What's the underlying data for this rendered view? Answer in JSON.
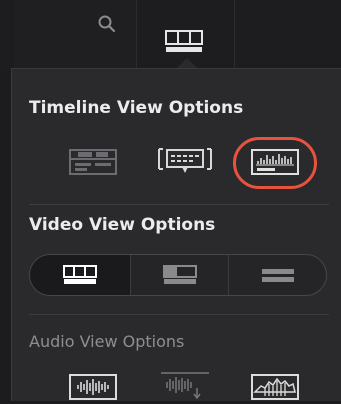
{
  "colors": {
    "background": "#1c1c1f",
    "popover": "#2a2a2d",
    "highlight": "#e8533f",
    "text": "#ececec",
    "text_dim": "#8e8e92"
  },
  "toolbar": {
    "icons": [
      "search-icon",
      "timeline-view-options-icon"
    ]
  },
  "popover": {
    "timeline_view": {
      "title": "Timeline View Options",
      "buttons": [
        "stacked-timelines-icon",
        "subtitle-track-icon",
        "audio-waveform-icon"
      ],
      "highlighted": "audio-waveform-icon"
    },
    "video_view": {
      "title": "Video View Options",
      "segments": [
        "filmstrip-view-icon",
        "thumbnail-view-icon",
        "continuous-view-icon"
      ],
      "selected": "filmstrip-view-icon"
    },
    "audio_view": {
      "title": "Audio View Options",
      "buttons": [
        "waveform-view-icon",
        "waveform-expand-icon",
        "waveform-peak-icon"
      ]
    }
  }
}
